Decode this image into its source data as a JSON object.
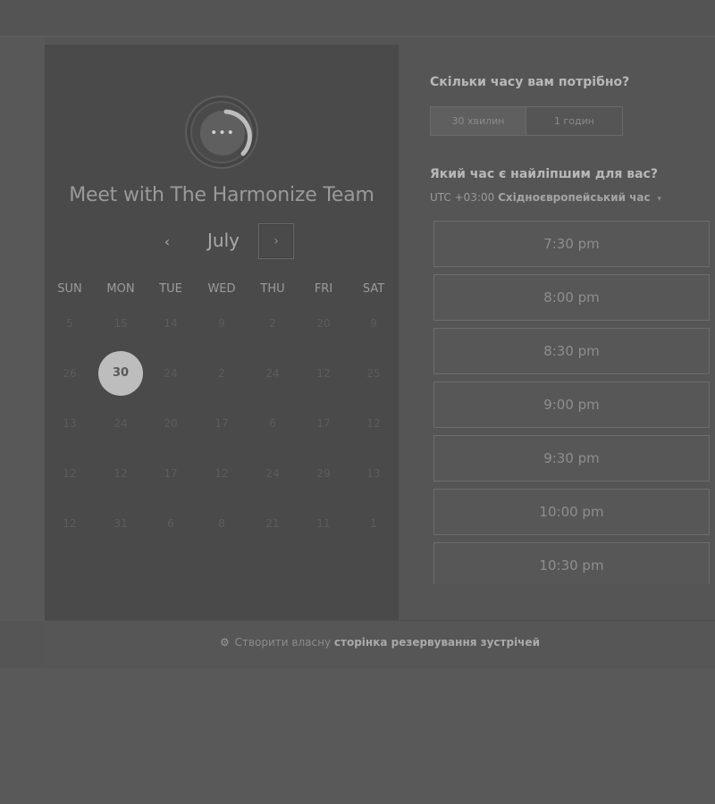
{
  "calendar": {
    "title": "Meet with The Harmonize Team",
    "month": "July",
    "prev_icon": "‹",
    "next_icon": "›",
    "weekdays": [
      "SUN",
      "MON",
      "TUE",
      "WED",
      "THU",
      "FRI",
      "SAT"
    ],
    "weeks": [
      [
        "5",
        "15",
        "14",
        "9",
        "2",
        "20",
        "9"
      ],
      [
        "26",
        "30",
        "24",
        "2",
        "24",
        "12",
        "25"
      ],
      [
        "13",
        "24",
        "20",
        "17",
        "6",
        "17",
        "12"
      ],
      [
        "12",
        "12",
        "17",
        "12",
        "24",
        "29",
        "13"
      ],
      [
        "12",
        "31",
        "6",
        "8",
        "21",
        "11",
        "1"
      ]
    ],
    "selected_day": "30"
  },
  "booking": {
    "duration_question": "Скільки часу вам потрібно?",
    "durations": [
      "30 хвилин",
      "1 годин"
    ],
    "selected_duration": "30 хвилин",
    "time_question": "Який час є найліпшим для вас?",
    "timezone_offset": "UTC +03:00",
    "timezone_name": "Східноєвропейський час",
    "timezone_caret": "▾",
    "slots": [
      "7:30 pm",
      "8:00 pm",
      "8:30 pm",
      "9:00 pm",
      "9:30 pm",
      "10:00 pm",
      "10:30 pm"
    ]
  },
  "footer": {
    "icon": "sprocket-icon",
    "text_prefix": "Створити власну",
    "text_bold": "сторінка резервування зустрічей"
  }
}
